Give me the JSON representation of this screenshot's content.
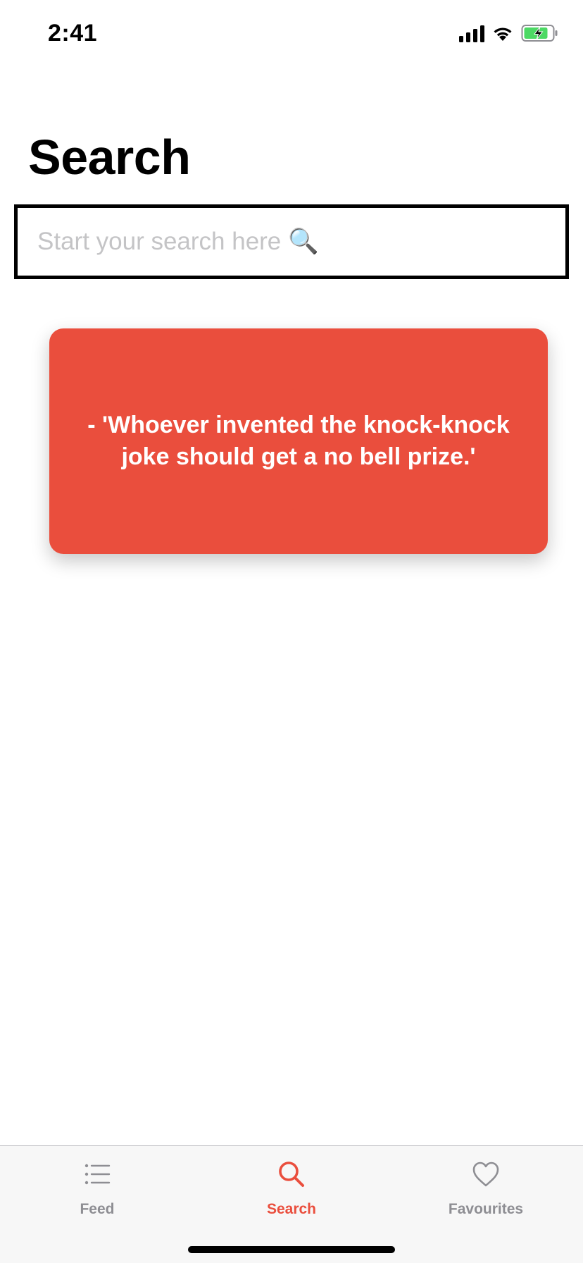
{
  "status_bar": {
    "time": "2:41"
  },
  "page": {
    "title": "Search"
  },
  "search": {
    "placeholder": "Start your search here 🔍",
    "value": ""
  },
  "joke_card": {
    "text": "-  'Whoever invented the knock-knock joke should get a no bell prize.'"
  },
  "tab_bar": {
    "tabs": [
      {
        "label": "Feed",
        "icon": "list-icon",
        "active": false
      },
      {
        "label": "Search",
        "icon": "search-icon",
        "active": true
      },
      {
        "label": "Favourites",
        "icon": "heart-icon",
        "active": false
      }
    ]
  },
  "colors": {
    "accent": "#ea4e3d",
    "tab_inactive": "#8e8e93",
    "tab_bar_bg": "#f7f7f7",
    "battery_fill": "#4cd964"
  }
}
